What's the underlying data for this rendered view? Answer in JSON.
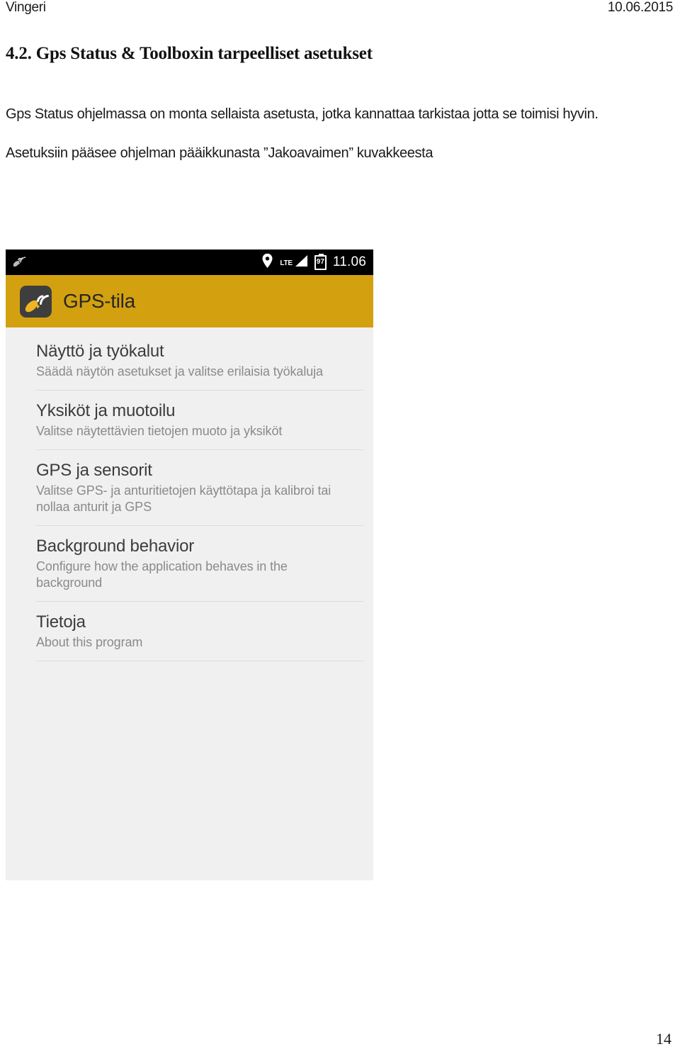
{
  "document": {
    "header": {
      "left_text": "Vingeri",
      "right_text": "10.06.2015"
    },
    "section_heading": "4.2. Gps Status & Toolboxin tarpeelliset asetukset",
    "paragraphs": [
      "Gps Status ohjelmassa on monta sellaista asetusta, jotka kannattaa tarkistaa jotta se toimisi hyvin.",
      "Asetuksiin pääsee ohjelman pääikkunasta ”Jakoavaimen” kuvakkeesta"
    ],
    "page_number": "14"
  },
  "screenshot": {
    "status_bar": {
      "notification_icon": "satellite-dish-icon",
      "location_icon": "location-pin-icon",
      "network_label": "LTE",
      "signal_icon": "signal-bars-icon",
      "battery_level": "97",
      "battery_icon": "battery-icon",
      "clock": "11.06"
    },
    "app_bar": {
      "icon": "gps-satellite-app-icon",
      "title": "GPS-tila",
      "background_color": "#d3a10f"
    },
    "settings": [
      {
        "title": "Näyttö ja työkalut",
        "subtitle": "Säädä näytön asetukset ja valitse erilaisia työkaluja"
      },
      {
        "title": "Yksiköt ja muotoilu",
        "subtitle": "Valitse näytettävien tietojen muoto ja yksiköt"
      },
      {
        "title": "GPS ja sensorit",
        "subtitle": "Valitse GPS- ja anturitietojen käyttötapa ja kalibroi tai nollaa anturit ja GPS"
      },
      {
        "title": "Background behavior",
        "subtitle": "Configure how the application behaves in the background"
      },
      {
        "title": "Tietoja",
        "subtitle": "About this program"
      }
    ],
    "colors": {
      "accent": "#d3a10f",
      "list_background": "#f0f0f0",
      "status_bar": "#000000",
      "divider": "#dcdcdc"
    }
  }
}
